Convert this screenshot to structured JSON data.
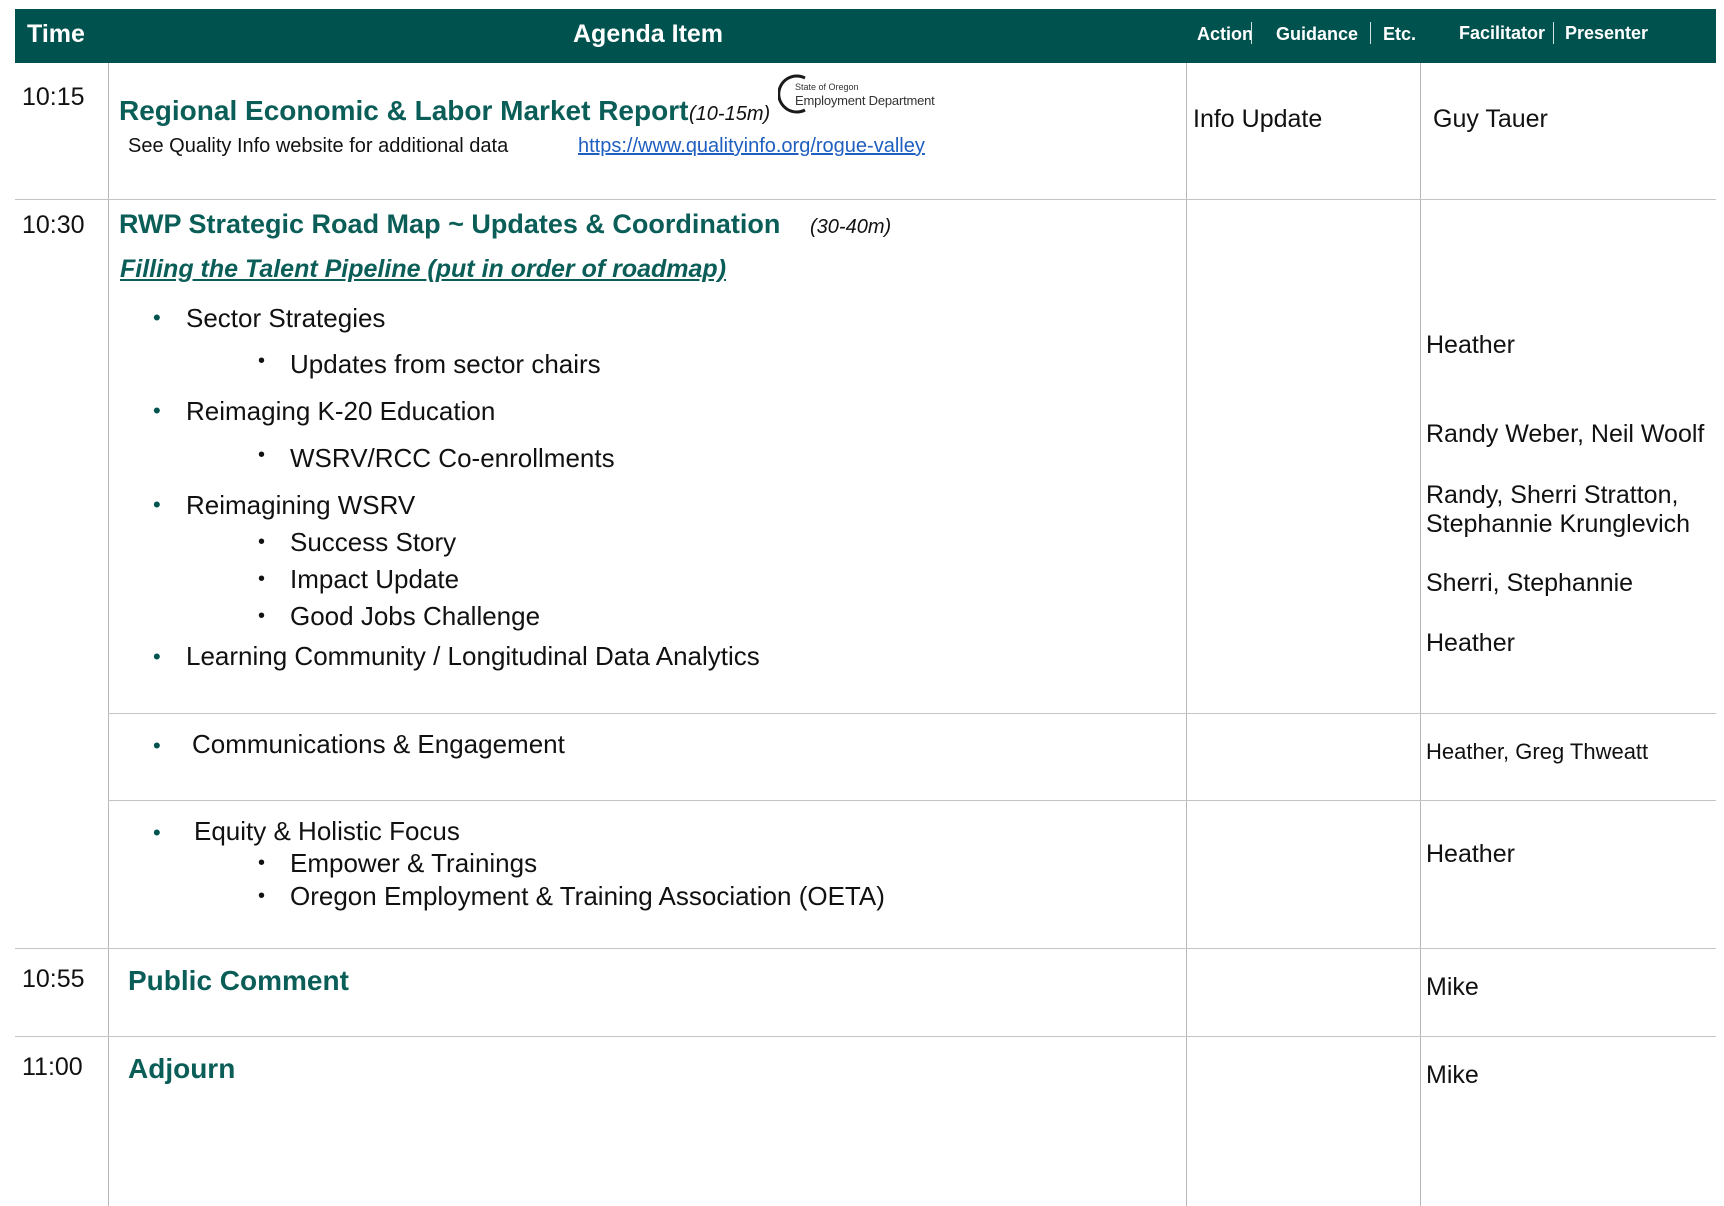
{
  "header": {
    "time": "Time",
    "agenda_item": "Agenda Item",
    "action": "Action",
    "guidance": "Guidance",
    "etc": "Etc.",
    "facilitator": "Facilitator",
    "presenter": "Presenter"
  },
  "rows": {
    "r1": {
      "time": "10:15",
      "title": "Regional Economic & Labor Market Report",
      "duration": "(10-15m)",
      "note": "See Quality Info website for additional data",
      "link": "https://www.qualityinfo.org/rogue-valley",
      "logo_line1": "State of Oregon",
      "logo_line2": "Employment Department",
      "action": "Info Update",
      "presenter": "Guy Tauer"
    },
    "r2": {
      "time": "10:30",
      "title": "RWP Strategic Road Map ~ Updates & Coordination",
      "duration": "(30-40m)",
      "subtitle": "Filling the Talent Pipeline (put in order of roadmap)",
      "items": {
        "sector": "Sector Strategies",
        "sector_sub": "Updates from sector chairs",
        "k20": "Reimaging K-20 Education",
        "k20_sub": "WSRV/RCC Co-enrollments",
        "wsrv": "Reimagining WSRV",
        "wsrv_sub1": "Success Story",
        "wsrv_sub2": "Impact Update",
        "wsrv_sub3": "Good Jobs Challenge",
        "learning": "Learning Community / Longitudinal Data Analytics"
      },
      "presenters": {
        "p1": "Heather",
        "p2": "Randy Weber, Neil Woolf",
        "p3a": "Randy, Sherri Stratton,",
        "p3b": "Stephannie Krunglevich",
        "p4": "Sherri, Stephannie",
        "p5": "Heather"
      }
    },
    "r3": {
      "item": "Communications & Engagement",
      "presenter": "Heather, Greg Thweatt"
    },
    "r4": {
      "item": "Equity & Holistic Focus",
      "sub1": "Empower & Trainings",
      "sub2": "Oregon Employment & Training Association (OETA)",
      "presenter": "Heather"
    },
    "r5": {
      "time": "10:55",
      "title": "Public Comment",
      "presenter": "Mike"
    },
    "r6": {
      "time": "11:00",
      "title": "Adjourn",
      "presenter": "Mike"
    }
  },
  "glyphs": {
    "teal_bullet": "•",
    "black_bullet": "•"
  },
  "colors": {
    "header_bg": "#00524f",
    "title": "#0b5e58",
    "link": "#1f5fbf"
  }
}
